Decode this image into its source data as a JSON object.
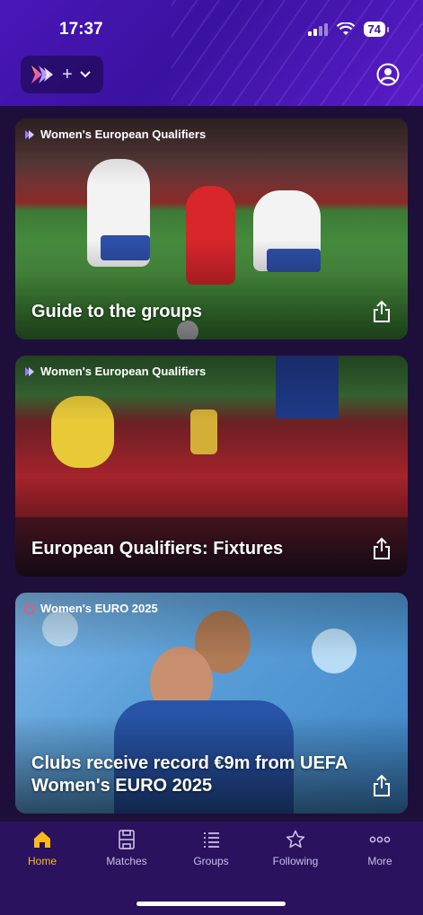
{
  "status_bar": {
    "time": "17:37",
    "battery": "74"
  },
  "header": {
    "switcher_plus": "+",
    "switcher_chevron": "⌄"
  },
  "feed": {
    "cards": [
      {
        "tag": "Women's European Qualifiers",
        "title": "Guide to the groups"
      },
      {
        "tag": "Women's European Qualifiers",
        "title": "European Qualifiers: Fixtures"
      },
      {
        "tag": "Women's EURO 2025",
        "title": "Clubs receive record €9m from UEFA Women's EURO 2025"
      }
    ]
  },
  "tabbar": {
    "items": [
      {
        "label": "Home",
        "icon": "home-icon",
        "active": true
      },
      {
        "label": "Matches",
        "icon": "pitch-icon"
      },
      {
        "label": "Groups",
        "icon": "list-icon"
      },
      {
        "label": "Following",
        "icon": "star-icon"
      },
      {
        "label": "More",
        "icon": "more-icon"
      }
    ],
    "active_color": "#ffb81c"
  },
  "colors": {
    "header": "#4a16b8",
    "background": "#1e0f3a",
    "tabbar": "#2b125e"
  }
}
